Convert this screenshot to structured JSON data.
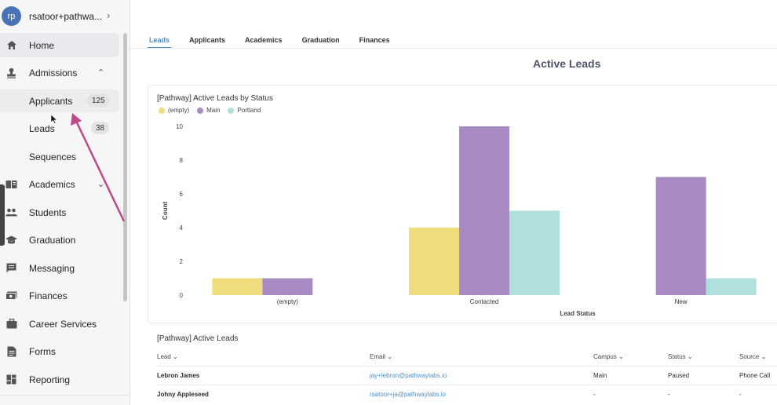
{
  "user": {
    "initials": "rp",
    "name": "rsatoor+pathwa..."
  },
  "nav": {
    "home": "Home",
    "admissions": "Admissions",
    "applicants": "Applicants",
    "applicants_count": "125",
    "leads": "Leads",
    "leads_count": "38",
    "sequences": "Sequences",
    "academics": "Academics",
    "students": "Students",
    "graduation": "Graduation",
    "messaging": "Messaging",
    "finances": "Finances",
    "career_services": "Career Services",
    "forms": "Forms",
    "reporting": "Reporting"
  },
  "tabs": [
    "Leads",
    "Applicants",
    "Academics",
    "Graduation",
    "Finances"
  ],
  "page_title": "Active Leads",
  "chart_card": {
    "title": "[Pathway] Active Leads by Status"
  },
  "chart_data": {
    "type": "bar",
    "title": "[Pathway] Active Leads by Status",
    "xlabel": "Lead Status",
    "ylabel": "Count",
    "categories": [
      "(empty)",
      "Contacted",
      "New"
    ],
    "series": [
      {
        "name": "(empty)",
        "color": "#eedc7d",
        "values": [
          1,
          4,
          0
        ]
      },
      {
        "name": "Main",
        "color": "#a98bc4",
        "values": [
          1,
          10,
          7
        ]
      },
      {
        "name": "Portland",
        "color": "#b0e0dc",
        "values": [
          0,
          5,
          1
        ]
      }
    ],
    "ylim": [
      0,
      10
    ],
    "yticks": [
      0,
      2,
      4,
      6,
      8,
      10
    ],
    "legend_position": "top-left",
    "grid": false
  },
  "table": {
    "title": "[Pathway] Active Leads",
    "columns": [
      "Lead",
      "Email",
      "Campus",
      "Status",
      "Source"
    ],
    "rows": [
      [
        "Lebron James",
        "jay+lebron@pathwaylabs.io",
        "Main",
        "Paused",
        "Phone Call"
      ],
      [
        "Johny Appleseed",
        "rsatoor+ja@pathwaylabs.io",
        "-",
        "-",
        "-"
      ]
    ]
  },
  "colors": {
    "accent": "#4a90c8",
    "arrow": "#c0478a",
    "avatar": "#4a73b3"
  }
}
